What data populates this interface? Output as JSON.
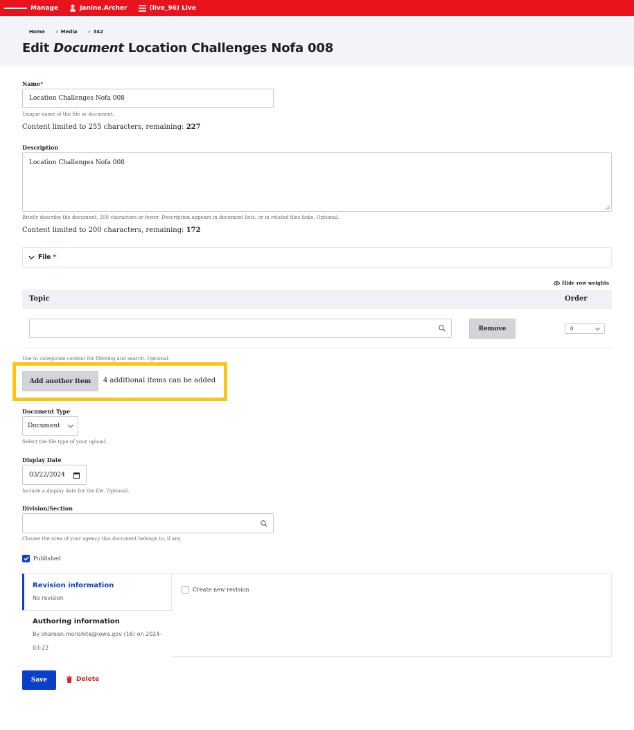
{
  "toolbar": {
    "manage_label": "Manage",
    "user_label": "Janine.Archer",
    "workspace_label": "(live_96) Live"
  },
  "breadcrumb": [
    "Home",
    "Media",
    "342"
  ],
  "page_title": {
    "prefix": "Edit",
    "type": "Document",
    "name": "Location Challenges Nofa 008"
  },
  "name_field": {
    "label": "Name",
    "required_mark": "*",
    "value": "Location Challenges Nofa 008",
    "hint": "Unique name of the file or document.",
    "counter_text": "Content limited to 255 characters, remaining:",
    "remaining": "227"
  },
  "description_field": {
    "label": "Description",
    "value": "Location Challenges Nofa 008",
    "hint": "Briefly describe the document, 200 characters or fewer. Description appears in document lists, or in related files links. Optional.",
    "counter_text": "Content limited to 200 characters, remaining:",
    "remaining": "172"
  },
  "file_section": {
    "label": "File",
    "required_mark": "*"
  },
  "topic_table": {
    "hide_weights_label": "Hide row weights",
    "columns": [
      "Topic",
      "Order"
    ],
    "rows": [
      {
        "topic_value": "",
        "remove_label": "Remove",
        "order_value": "0"
      }
    ],
    "hint": "Use to categorize content for filtering and search. Optional.",
    "add_button_label": "Add another item",
    "add_note": "4 additional items can be added"
  },
  "document_type": {
    "label": "Document Type",
    "selected": "Document",
    "hint": "Select the file type of your upload."
  },
  "display_date": {
    "label": "Display Date",
    "value": "03/22/2024",
    "hint": "Include a display date for the file. Optional."
  },
  "division": {
    "label": "Division/Section",
    "value": "",
    "hint": "Choose the area of your agency this document belongs to, if any."
  },
  "published": {
    "label": "Published",
    "checked": true
  },
  "revision_tabs": {
    "revision_title": "Revision information",
    "revision_sub": "No revision",
    "authoring_title": "Authoring information",
    "authoring_sub": "By sharean.morishita@iowa.gov (16) on 2024-03-22",
    "create_revision_label": "Create new revision",
    "create_revision_checked": false
  },
  "actions": {
    "save_label": "Save",
    "delete_label": "Delete"
  },
  "colors": {
    "toolbar_red": "#e8131c",
    "primary_blue": "#0a3fc9",
    "highlight_yellow": "#fcc515",
    "danger_red": "#d72222"
  }
}
